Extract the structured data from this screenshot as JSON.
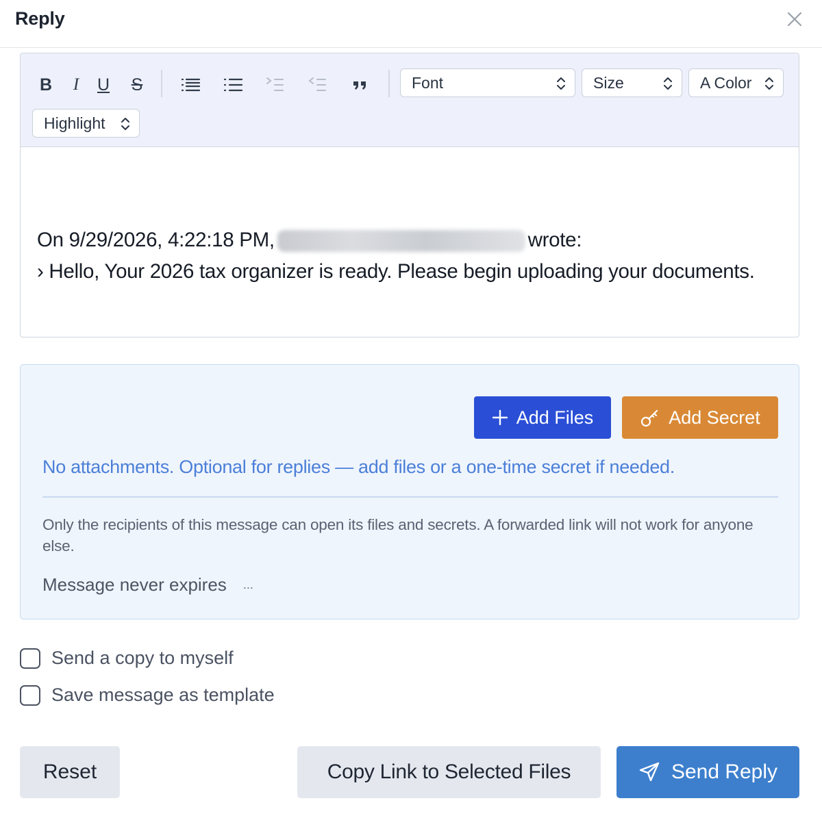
{
  "header": {
    "title": "Reply",
    "close_icon": "close-icon"
  },
  "toolbar": {
    "format_buttons": [
      {
        "name": "bold",
        "glyph": "B"
      },
      {
        "name": "italic",
        "glyph": "I"
      },
      {
        "name": "underline",
        "glyph": "U"
      },
      {
        "name": "strikethrough",
        "glyph": "S"
      }
    ],
    "list_buttons": [
      "ordered-list-icon",
      "bullet-list-icon",
      "indent-icon",
      "outdent-icon",
      "blockquote-icon"
    ],
    "font_label": "Font",
    "size_label": "Size",
    "color_label": "A Color",
    "highlight_label": "Highlight"
  },
  "editor": {
    "quote_header_prefix": "On 9/29/2026, 4:22:18 PM,",
    "quote_header_suffix": "wrote:",
    "quote_body": "› Hello, Your 2026 tax organizer is ready. Please begin uploading your documents."
  },
  "attachments": {
    "add_files_label": "Add Files",
    "add_secret_label": "Add Secret",
    "empty_text": "No attachments. Optional for replies — add files or a one-time secret if needed.",
    "security_note": "Only the recipients of this message can open its files and secrets. A forwarded link will not work for anyone else.",
    "expiry_text": "Message never expires",
    "expiry_more": "..."
  },
  "options": {
    "send_copy_label": "Send a copy to myself",
    "save_template_label": "Save message as template"
  },
  "footer": {
    "reset_label": "Reset",
    "copy_link_label": "Copy Link to Selected Files",
    "send_label": "Send Reply"
  },
  "colors": {
    "primary_blue": "#2a4fd6",
    "secret_orange": "#d98935",
    "send_blue": "#3d7fcd",
    "hint_blue": "#4b7fd8",
    "panel_bg": "#eff5fc"
  }
}
